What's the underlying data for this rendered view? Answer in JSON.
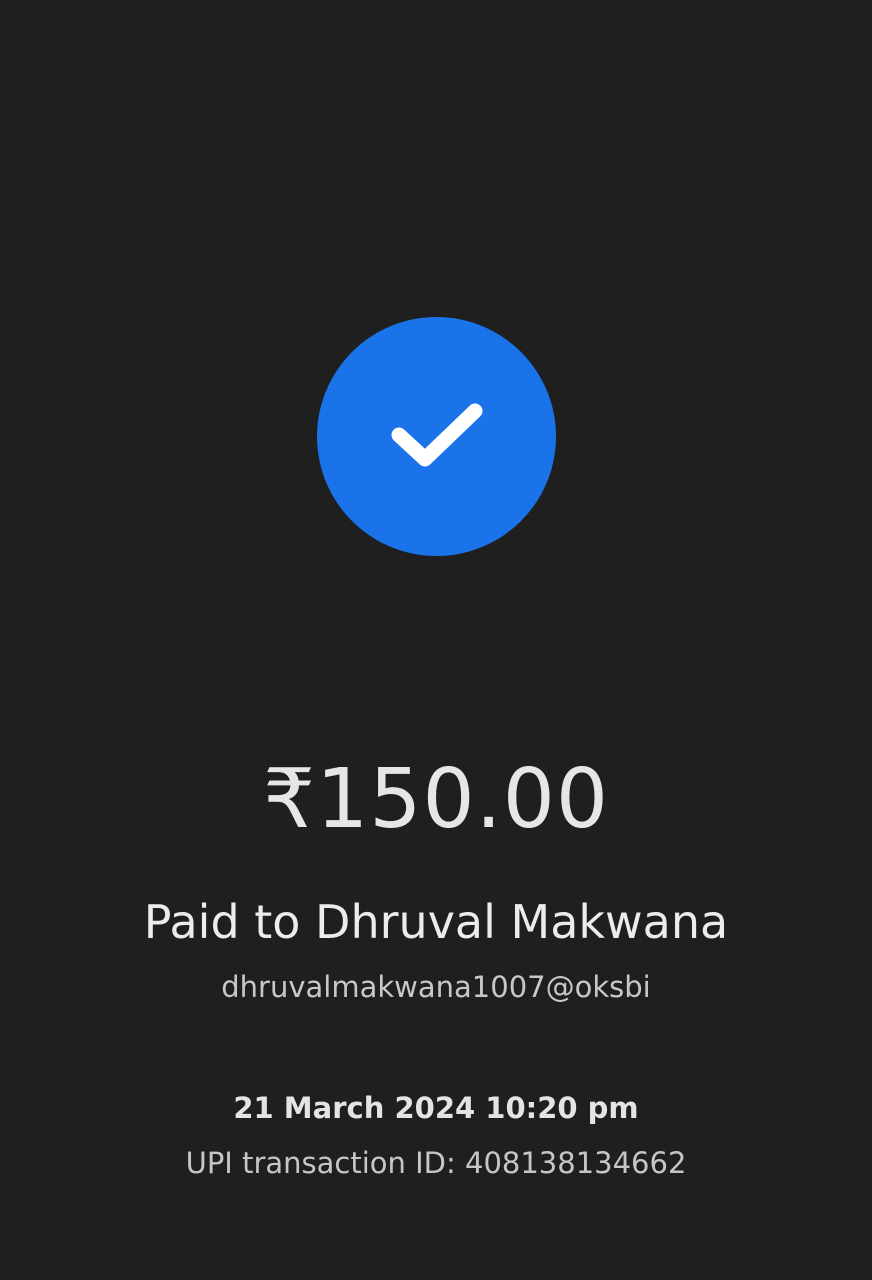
{
  "status_icon": {
    "name": "check-icon",
    "circle_color": "#1a73e8",
    "check_color": "#ffffff"
  },
  "payment": {
    "amount": "₹150.00",
    "paid_to": "Paid to Dhruval Makwana",
    "upi_id": "dhruvalmakwana1007@oksbi",
    "datetime": "21 March 2024 10:20 pm",
    "transaction_id": "UPI transaction ID: 408138134662"
  }
}
